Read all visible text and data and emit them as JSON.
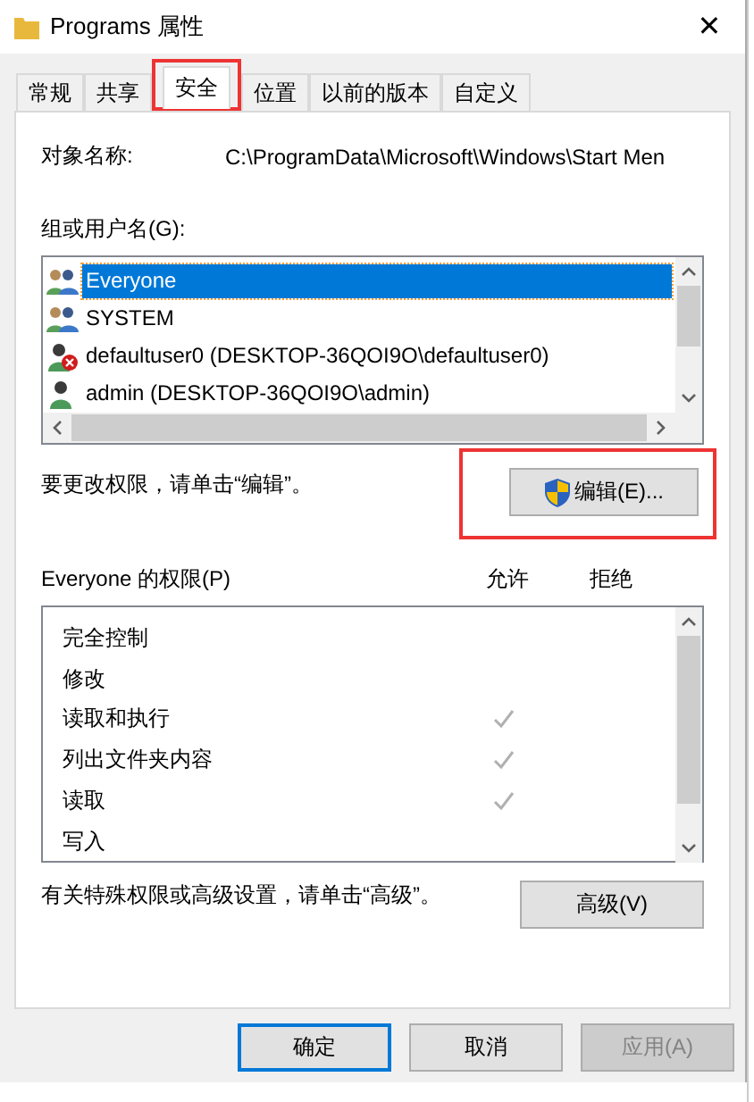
{
  "window": {
    "title": "Programs 属性",
    "close": "✕"
  },
  "tabs": [
    {
      "label": "常规",
      "selected": false,
      "highlighted": false
    },
    {
      "label": "共享",
      "selected": false,
      "highlighted": false
    },
    {
      "label": "安全",
      "selected": true,
      "highlighted": true
    },
    {
      "label": "位置",
      "selected": false,
      "highlighted": false
    },
    {
      "label": "以前的版本",
      "selected": false,
      "highlighted": false
    },
    {
      "label": "自定义",
      "selected": false,
      "highlighted": false
    }
  ],
  "object_name": {
    "label": "对象名称:",
    "value": "C:\\ProgramData\\Microsoft\\Windows\\Start Men"
  },
  "users": {
    "label": "组或用户名(G):",
    "items": [
      {
        "name": "Everyone",
        "kind": "group",
        "selected": true
      },
      {
        "name": "SYSTEM",
        "kind": "group",
        "selected": false
      },
      {
        "name": "defaultuser0 (DESKTOP-36QOI9O\\defaultuser0)",
        "kind": "blocked-user",
        "selected": false
      },
      {
        "name": "admin (DESKTOP-36QOI9O\\admin)",
        "kind": "user",
        "selected": false
      }
    ]
  },
  "edit_hint": "要更改权限，请单击“编辑”。",
  "edit_button": {
    "label": "编辑(E)...",
    "highlighted": true
  },
  "permissions": {
    "label": "Everyone 的权限(P)",
    "allow_label": "允许",
    "deny_label": "拒绝",
    "rows": [
      {
        "name": "完全控制",
        "allow": false,
        "deny": false
      },
      {
        "name": "修改",
        "allow": false,
        "deny": false
      },
      {
        "name": "读取和执行",
        "allow": true,
        "deny": false
      },
      {
        "name": "列出文件夹内容",
        "allow": true,
        "deny": false
      },
      {
        "name": "读取",
        "allow": true,
        "deny": false
      },
      {
        "name": "写入",
        "allow": false,
        "deny": false
      }
    ]
  },
  "advanced_hint": "有关特殊权限或高级设置，请单击“高级”。",
  "advanced_button": "高级(V)",
  "buttons": [
    {
      "label": "确定",
      "default": true,
      "disabled": false
    },
    {
      "label": "取消",
      "default": false,
      "disabled": false
    },
    {
      "label": "应用(A)",
      "default": false,
      "disabled": true
    }
  ]
}
